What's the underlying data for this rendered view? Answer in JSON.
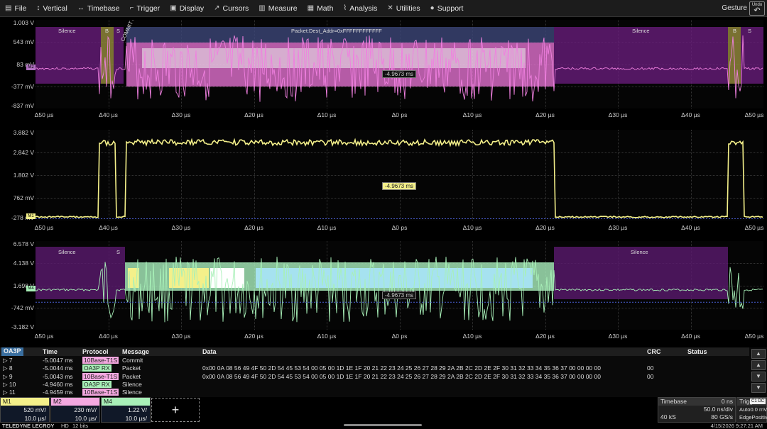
{
  "menu": {
    "items": [
      {
        "label": "File",
        "icon": "folder-icon",
        "glyph": "▤"
      },
      {
        "label": "Vertical",
        "icon": "vertical-arrows-icon",
        "glyph": "↕"
      },
      {
        "label": "Timebase",
        "icon": "horizontal-arrows-icon",
        "glyph": "↔"
      },
      {
        "label": "Trigger",
        "icon": "trigger-icon",
        "glyph": "⌐"
      },
      {
        "label": "Display",
        "icon": "display-icon",
        "glyph": "▣"
      },
      {
        "label": "Cursors",
        "icon": "cursors-icon",
        "glyph": "↗"
      },
      {
        "label": "Measure",
        "icon": "measure-icon",
        "glyph": "▥"
      },
      {
        "label": "Math",
        "icon": "math-icon",
        "glyph": "▦"
      },
      {
        "label": "Analysis",
        "icon": "analysis-icon",
        "glyph": "⌇"
      },
      {
        "label": "Utilities",
        "icon": "utilities-icon",
        "glyph": "✕"
      },
      {
        "label": "Support",
        "icon": "support-icon",
        "glyph": "●"
      }
    ],
    "gesture": "Gesture",
    "undo": "Undo"
  },
  "panels": [
    {
      "id": "m2",
      "color": "#f080e0",
      "ylabels": [
        "1.003 V",
        "543 mV",
        "83 mV",
        "-377 mV",
        "-837 mV"
      ],
      "marker": "M2",
      "delta": "-4.9673 ms",
      "segments": {
        "silence": "Silence",
        "b": "B",
        "s": "S",
        "packet": "Packet:Dest_Addr=0xFFFFFFFFFFFF",
        "commit": "COMMIT C"
      }
    },
    {
      "id": "m1",
      "color": "#f4f08a",
      "ylabels": [
        "3.882 V",
        "2.842 V",
        "1.802 V",
        "762 mV",
        "-278 mV"
      ],
      "marker": "M1",
      "delta": "-4.9673 ms"
    },
    {
      "id": "m4",
      "color": "#a8f0b8",
      "ylabels": [
        "6.578 V",
        "4.138 V",
        "1.698 V",
        "-742 mV",
        "-3.182 V"
      ],
      "marker": "M4",
      "delta": "-4.9673 ms",
      "segments": {
        "silence": "Silence",
        "s": "S"
      }
    }
  ],
  "xaxis": [
    "Δ50 µs",
    "Δ40 µs",
    "Δ30 µs",
    "Δ20 µs",
    "Δ10 µs",
    "Δ0 ps",
    "Δ10 µs",
    "Δ20 µs",
    "Δ30 µs",
    "Δ40 µs",
    "Δ50 µs"
  ],
  "decode": {
    "headers": {
      "src": "OA3P",
      "time": "Time",
      "protocol": "Protocol",
      "message": "Message",
      "data": "Data",
      "crc": "CRC",
      "status": "Status"
    },
    "rows": [
      {
        "idx": "▷ 7",
        "time": "-5.0047 ms",
        "protocol": "10Base-T1S",
        "pcolor": "#f4a8e0",
        "message": "Commit",
        "data": "",
        "crc": ""
      },
      {
        "idx": "▷ 8",
        "time": "-5.0044 ms",
        "protocol": "OA3P RX",
        "pcolor": "#a8f0b8",
        "message": "Packet",
        "data": "0x00 0A 08 56 49 4F 50 2D 54 45 53 54 00 05 00 1D 1E 1F 20 21 22 23 24 25 26 27 28 29 2A 2B 2C 2D 2E 2F 30 31 32 33 34 35 36 37 00 00 00 00",
        "crc": "00"
      },
      {
        "idx": "▷ 9",
        "time": "-5.0043 ms",
        "protocol": "10Base-T1S",
        "pcolor": "#f4a8e0",
        "message": "Packet",
        "data": "0x00 0A 08 56 49 4F 50 2D 54 45 53 54 00 05 00 1D 1E 1F 20 21 22 23 24 25 26 27 28 29 2A 2B 2C 2D 2E 2F 30 31 32 33 34 35 36 37 00 00 00 00",
        "crc": "00"
      },
      {
        "idx": "▷ 10",
        "time": "-4.9460 ms",
        "protocol": "OA3P RX",
        "pcolor": "#a8f0b8",
        "message": "Silence",
        "data": "",
        "crc": ""
      },
      {
        "idx": "▷ 11",
        "time": "-4.9459 ms",
        "protocol": "10Base-T1S",
        "pcolor": "#f4a8e0",
        "message": "Silence",
        "data": "",
        "crc": ""
      }
    ]
  },
  "descriptors": [
    {
      "name": "M1",
      "color": "#f4f08a",
      "v1": "520 mV/",
      "v2": "10.0 µs/"
    },
    {
      "name": "M2",
      "color": "#f4a8e0",
      "v1": "230 mV/",
      "v2": "10.0 µs/"
    },
    {
      "name": "M4",
      "color": "#a8f0b8",
      "v1": "1.22 V/",
      "v2": "10.0 µs/"
    }
  ],
  "add_label": "+",
  "timebase": {
    "title": "Timebase",
    "offset": "0 ns",
    "rows": [
      [
        "",
        "50.0 ns/div"
      ],
      [
        "40 kS",
        "80 GS/s"
      ]
    ]
  },
  "trigger": {
    "title": "Trigger",
    "badge": "C1 DC",
    "rows": [
      [
        "Auto",
        "0.0 mV"
      ],
      [
        "Edge",
        "Positive"
      ]
    ]
  },
  "status": {
    "brand": "TELEDYNE LECROY",
    "mode": "HD",
    "bits": "12 bits",
    "datetime": "4/15/2026 9:27:21 AM"
  }
}
